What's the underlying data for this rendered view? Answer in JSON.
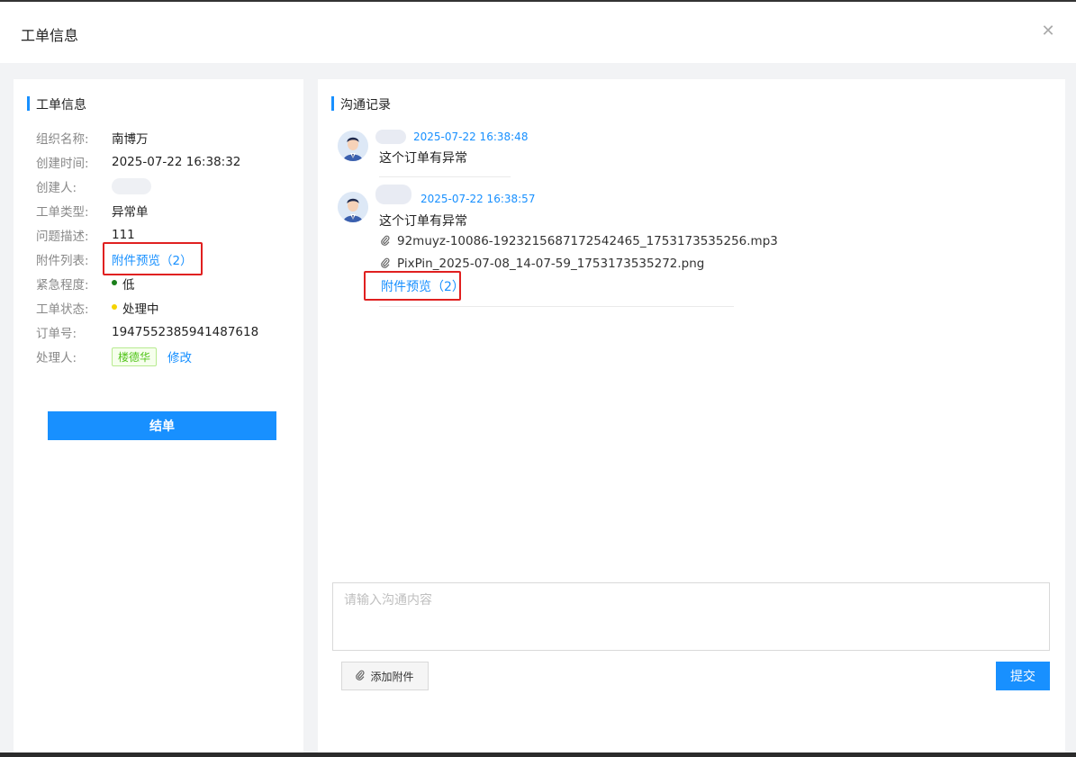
{
  "modal": {
    "title": "工单信息"
  },
  "left": {
    "section_title": "工单信息",
    "rows": [
      {
        "label": "组织名称:",
        "value": "南博万"
      },
      {
        "label": "创建时间:",
        "value": "2025-07-22 16:38:32"
      },
      {
        "label": "创建人:",
        "value": ""
      },
      {
        "label": "工单类型:",
        "value": "异常单"
      },
      {
        "label": "问题描述:",
        "value": "111"
      },
      {
        "label": "附件列表:",
        "value": "附件预览（2）"
      },
      {
        "label": "紧急程度:",
        "value": "低"
      },
      {
        "label": "工单状态:",
        "value": "处理中"
      },
      {
        "label": "订单号:",
        "value": "1947552385941487618"
      },
      {
        "label": "处理人:",
        "value": "楼德华",
        "action": "修改"
      }
    ],
    "close_button": "结单",
    "colors": {
      "urgency_dot": "#1a7f1a",
      "status_dot": "#f5d300"
    }
  },
  "right": {
    "section_title": "沟通记录",
    "messages": [
      {
        "time": "2025-07-22 16:38:48",
        "text": "这个订单有异常",
        "attachments": []
      },
      {
        "time": "2025-07-22 16:38:57",
        "text": "这个订单有异常",
        "attachments": [
          "92muyz-10086-1923215687172542465_1753173535256.mp3",
          "PixPin_2025-07-08_14-07-59_1753173535272.png"
        ],
        "preview_link": "附件预览（2）"
      }
    ],
    "input_placeholder": "请输入沟通内容",
    "attach_button": "添加附件",
    "submit_button": "提交"
  },
  "icons": {
    "close": "close-icon",
    "clip": "paperclip-icon",
    "avatar": "user-avatar-icon"
  },
  "accent_color": "#1890ff"
}
